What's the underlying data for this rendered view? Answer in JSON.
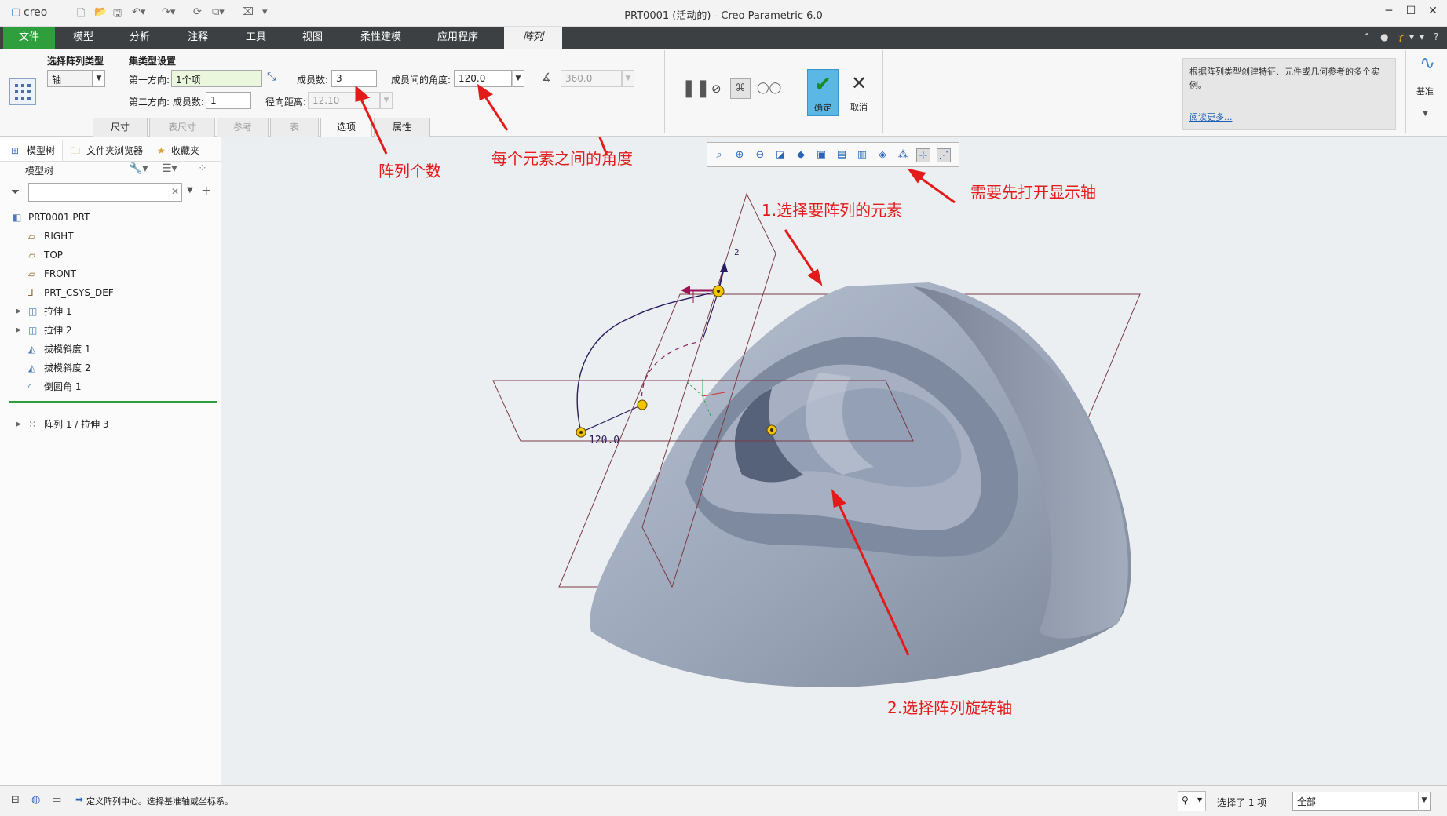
{
  "window": {
    "logo": "creo",
    "title": "PRT0001 (活动的) - Creo Parametric 6.0"
  },
  "tabs": [
    {
      "label": "文件"
    },
    {
      "label": "模型"
    },
    {
      "label": "分析"
    },
    {
      "label": "注释"
    },
    {
      "label": "工具"
    },
    {
      "label": "视图"
    },
    {
      "label": "柔性建模"
    },
    {
      "label": "应用程序"
    },
    {
      "label": "阵列"
    }
  ],
  "ribbon": {
    "pattern_type_label": "选择阵列类型",
    "pattern_type_value": "轴",
    "set_type_label": "集类型设置",
    "dir1_label": "第一方向:",
    "dir1_value": "1个项",
    "members_label": "成员数:",
    "members_value": "3",
    "angle_label": "成员间的角度:",
    "angle_value": "120.0",
    "angle_total_value": "360.0",
    "dir2_label": "第二方向: 成员数:",
    "dir2_value": "1",
    "radial_label": "径向距离:",
    "radial_value": "12.10",
    "subtabs": [
      "尺寸",
      "表尺寸",
      "参考",
      "表",
      "选项",
      "属性"
    ],
    "ok_label": "确定",
    "cancel_label": "取消",
    "help_text": "根据阵列类型创建特征、元件或几何参考的多个实例。",
    "help_link": "阅读更多...",
    "datum_label": "基准"
  },
  "left_panel": {
    "tabs": [
      "模型树",
      "文件夹浏览器",
      "收藏夹"
    ],
    "tree_title": "模型树",
    "search_placeholder": "",
    "items": [
      {
        "label": "PRT0001.PRT",
        "icon": "part-icon"
      },
      {
        "label": "RIGHT",
        "icon": "datum-plane-icon"
      },
      {
        "label": "TOP",
        "icon": "datum-plane-icon"
      },
      {
        "label": "FRONT",
        "icon": "datum-plane-icon"
      },
      {
        "label": "PRT_CSYS_DEF",
        "icon": "csys-icon"
      },
      {
        "label": "拉伸 1",
        "icon": "extrude-icon"
      },
      {
        "label": "拉伸 2",
        "icon": "extrude-icon"
      },
      {
        "label": "拔模斜度 1",
        "icon": "draft-icon"
      },
      {
        "label": "拔模斜度 2",
        "icon": "draft-icon"
      },
      {
        "label": "倒圆角 1",
        "icon": "round-icon"
      },
      {
        "label": "阵列 1 / 拉伸 3",
        "icon": "pattern-icon"
      }
    ]
  },
  "viewport": {
    "dim_label": "120.0",
    "axis_label": "2"
  },
  "annotations": {
    "count": "阵列个数",
    "angle": "每个元素之间的角度",
    "axis_display": "需要先打开显示轴",
    "step1": "1.选择要阵列的元素",
    "step2": "2.选择阵列旋转轴"
  },
  "status": {
    "message": "定义阵列中心。选择基准轴或坐标系。",
    "selected": "选择了 1 项",
    "filter": "全部"
  },
  "colors": {
    "file_tab": "#2f9e3d",
    "tabbar": "#3c4043",
    "annotation": "#e31a1a",
    "model": "#8a96ab"
  }
}
